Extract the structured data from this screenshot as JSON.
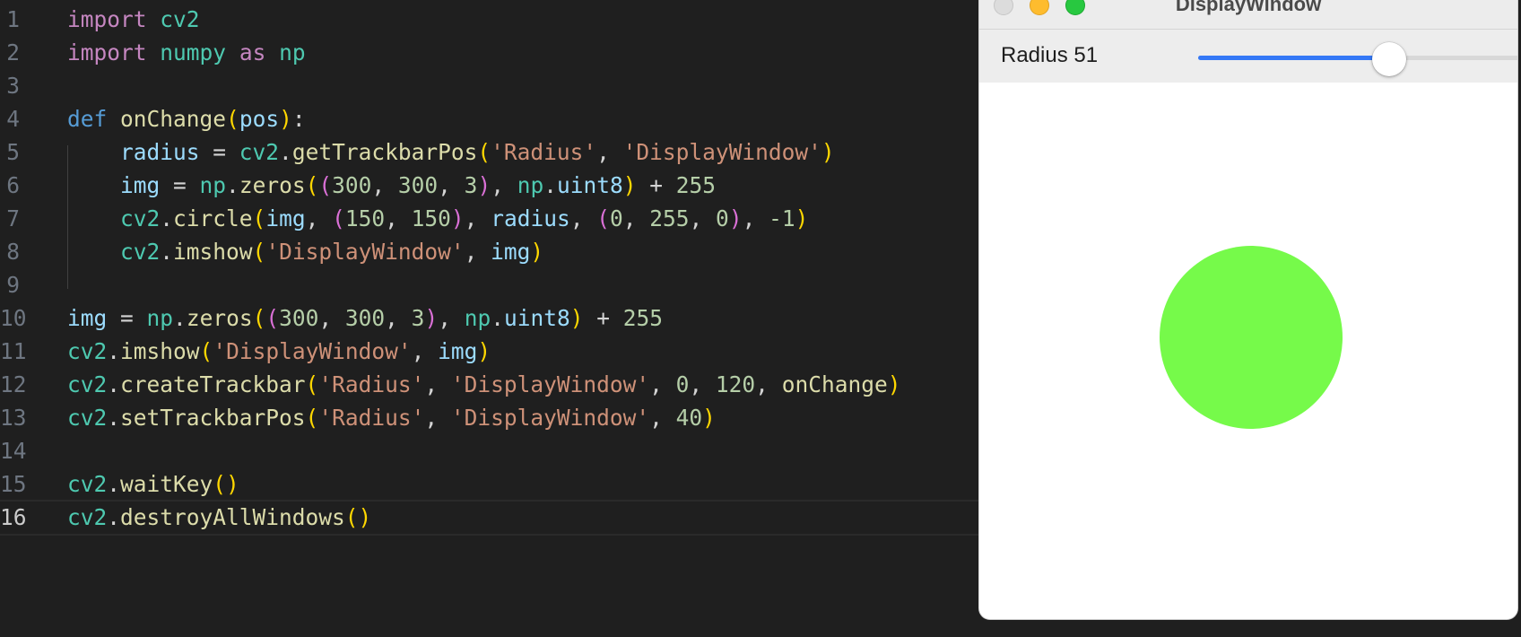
{
  "editor": {
    "lines": [
      {
        "n": "1",
        "tokens": [
          {
            "t": "import",
            "c": "kw"
          },
          {
            "t": " ",
            "c": "op"
          },
          {
            "t": "cv2",
            "c": "mod"
          }
        ]
      },
      {
        "n": "2",
        "tokens": [
          {
            "t": "import",
            "c": "kw"
          },
          {
            "t": " ",
            "c": "op"
          },
          {
            "t": "numpy",
            "c": "mod"
          },
          {
            "t": " ",
            "c": "op"
          },
          {
            "t": "as",
            "c": "kw"
          },
          {
            "t": " ",
            "c": "op"
          },
          {
            "t": "np",
            "c": "mod"
          }
        ]
      },
      {
        "n": "3",
        "tokens": []
      },
      {
        "n": "4",
        "tokens": [
          {
            "t": "def",
            "c": "def"
          },
          {
            "t": " ",
            "c": "op"
          },
          {
            "t": "onChange",
            "c": "fn"
          },
          {
            "t": "(",
            "c": "p1"
          },
          {
            "t": "pos",
            "c": "var"
          },
          {
            "t": ")",
            "c": "p1"
          },
          {
            "t": ":",
            "c": "op"
          }
        ]
      },
      {
        "n": "5",
        "tokens": [
          {
            "t": "    radius",
            "c": "var"
          },
          {
            "t": " = ",
            "c": "op"
          },
          {
            "t": "cv2",
            "c": "mod"
          },
          {
            "t": ".",
            "c": "op"
          },
          {
            "t": "getTrackbarPos",
            "c": "fn"
          },
          {
            "t": "(",
            "c": "p1"
          },
          {
            "t": "'Radius'",
            "c": "str"
          },
          {
            "t": ", ",
            "c": "op"
          },
          {
            "t": "'DisplayWindow'",
            "c": "str"
          },
          {
            "t": ")",
            "c": "p1"
          }
        ]
      },
      {
        "n": "6",
        "tokens": [
          {
            "t": "    img",
            "c": "var"
          },
          {
            "t": " = ",
            "c": "op"
          },
          {
            "t": "np",
            "c": "mod"
          },
          {
            "t": ".",
            "c": "op"
          },
          {
            "t": "zeros",
            "c": "fn"
          },
          {
            "t": "(",
            "c": "p1"
          },
          {
            "t": "(",
            "c": "p2"
          },
          {
            "t": "300",
            "c": "num"
          },
          {
            "t": ", ",
            "c": "op"
          },
          {
            "t": "300",
            "c": "num"
          },
          {
            "t": ", ",
            "c": "op"
          },
          {
            "t": "3",
            "c": "num"
          },
          {
            "t": ")",
            "c": "p2"
          },
          {
            "t": ", ",
            "c": "op"
          },
          {
            "t": "np",
            "c": "mod"
          },
          {
            "t": ".",
            "c": "op"
          },
          {
            "t": "uint8",
            "c": "var"
          },
          {
            "t": ")",
            "c": "p1"
          },
          {
            "t": " + ",
            "c": "op"
          },
          {
            "t": "255",
            "c": "num"
          }
        ]
      },
      {
        "n": "7",
        "tokens": [
          {
            "t": "    cv2",
            "c": "mod"
          },
          {
            "t": ".",
            "c": "op"
          },
          {
            "t": "circle",
            "c": "fn"
          },
          {
            "t": "(",
            "c": "p1"
          },
          {
            "t": "img",
            "c": "var"
          },
          {
            "t": ", ",
            "c": "op"
          },
          {
            "t": "(",
            "c": "p2"
          },
          {
            "t": "150",
            "c": "num"
          },
          {
            "t": ", ",
            "c": "op"
          },
          {
            "t": "150",
            "c": "num"
          },
          {
            "t": ")",
            "c": "p2"
          },
          {
            "t": ", ",
            "c": "op"
          },
          {
            "t": "radius",
            "c": "var"
          },
          {
            "t": ", ",
            "c": "op"
          },
          {
            "t": "(",
            "c": "p2"
          },
          {
            "t": "0",
            "c": "num"
          },
          {
            "t": ", ",
            "c": "op"
          },
          {
            "t": "255",
            "c": "num"
          },
          {
            "t": ", ",
            "c": "op"
          },
          {
            "t": "0",
            "c": "num"
          },
          {
            "t": ")",
            "c": "p2"
          },
          {
            "t": ", ",
            "c": "op"
          },
          {
            "t": "-1",
            "c": "num"
          },
          {
            "t": ")",
            "c": "p1"
          }
        ]
      },
      {
        "n": "8",
        "tokens": [
          {
            "t": "    cv2",
            "c": "mod"
          },
          {
            "t": ".",
            "c": "op"
          },
          {
            "t": "imshow",
            "c": "fn"
          },
          {
            "t": "(",
            "c": "p1"
          },
          {
            "t": "'DisplayWindow'",
            "c": "str"
          },
          {
            "t": ", ",
            "c": "op"
          },
          {
            "t": "img",
            "c": "var"
          },
          {
            "t": ")",
            "c": "p1"
          }
        ]
      },
      {
        "n": "9",
        "tokens": []
      },
      {
        "n": "10",
        "tokens": [
          {
            "t": "img",
            "c": "var"
          },
          {
            "t": " = ",
            "c": "op"
          },
          {
            "t": "np",
            "c": "mod"
          },
          {
            "t": ".",
            "c": "op"
          },
          {
            "t": "zeros",
            "c": "fn"
          },
          {
            "t": "(",
            "c": "p1"
          },
          {
            "t": "(",
            "c": "p2"
          },
          {
            "t": "300",
            "c": "num"
          },
          {
            "t": ", ",
            "c": "op"
          },
          {
            "t": "300",
            "c": "num"
          },
          {
            "t": ", ",
            "c": "op"
          },
          {
            "t": "3",
            "c": "num"
          },
          {
            "t": ")",
            "c": "p2"
          },
          {
            "t": ", ",
            "c": "op"
          },
          {
            "t": "np",
            "c": "mod"
          },
          {
            "t": ".",
            "c": "op"
          },
          {
            "t": "uint8",
            "c": "var"
          },
          {
            "t": ")",
            "c": "p1"
          },
          {
            "t": " + ",
            "c": "op"
          },
          {
            "t": "255",
            "c": "num"
          }
        ]
      },
      {
        "n": "11",
        "tokens": [
          {
            "t": "cv2",
            "c": "mod"
          },
          {
            "t": ".",
            "c": "op"
          },
          {
            "t": "imshow",
            "c": "fn"
          },
          {
            "t": "(",
            "c": "p1"
          },
          {
            "t": "'DisplayWindow'",
            "c": "str"
          },
          {
            "t": ", ",
            "c": "op"
          },
          {
            "t": "img",
            "c": "var"
          },
          {
            "t": ")",
            "c": "p1"
          }
        ]
      },
      {
        "n": "12",
        "tokens": [
          {
            "t": "cv2",
            "c": "mod"
          },
          {
            "t": ".",
            "c": "op"
          },
          {
            "t": "createTrackbar",
            "c": "fn"
          },
          {
            "t": "(",
            "c": "p1"
          },
          {
            "t": "'Radius'",
            "c": "str"
          },
          {
            "t": ", ",
            "c": "op"
          },
          {
            "t": "'DisplayWindow'",
            "c": "str"
          },
          {
            "t": ", ",
            "c": "op"
          },
          {
            "t": "0",
            "c": "num"
          },
          {
            "t": ", ",
            "c": "op"
          },
          {
            "t": "120",
            "c": "num"
          },
          {
            "t": ", ",
            "c": "op"
          },
          {
            "t": "onChange",
            "c": "fn"
          },
          {
            "t": ")",
            "c": "p1"
          }
        ]
      },
      {
        "n": "13",
        "tokens": [
          {
            "t": "cv2",
            "c": "mod"
          },
          {
            "t": ".",
            "c": "op"
          },
          {
            "t": "setTrackbarPos",
            "c": "fn"
          },
          {
            "t": "(",
            "c": "p1"
          },
          {
            "t": "'Radius'",
            "c": "str"
          },
          {
            "t": ", ",
            "c": "op"
          },
          {
            "t": "'DisplayWindow'",
            "c": "str"
          },
          {
            "t": ", ",
            "c": "op"
          },
          {
            "t": "40",
            "c": "num"
          },
          {
            "t": ")",
            "c": "p1"
          }
        ]
      },
      {
        "n": "14",
        "tokens": []
      },
      {
        "n": "15",
        "tokens": [
          {
            "t": "cv2",
            "c": "mod"
          },
          {
            "t": ".",
            "c": "op"
          },
          {
            "t": "waitKey",
            "c": "fn"
          },
          {
            "t": "()",
            "c": "p1"
          }
        ]
      },
      {
        "n": "16",
        "tokens": [
          {
            "t": "cv2",
            "c": "mod"
          },
          {
            "t": ".",
            "c": "op"
          },
          {
            "t": "destroyAllWindows",
            "c": "fn"
          },
          {
            "t": "()",
            "c": "p1"
          }
        ]
      }
    ],
    "current_line": "16"
  },
  "display_window": {
    "title": "DisplayWindow",
    "trackbar": {
      "label": "Radius 51",
      "name": "Radius",
      "value": 51,
      "min": 0,
      "max": 120
    },
    "circle_color": "#76fa4a"
  },
  "colors": {
    "editor_bg": "#1f1f1f",
    "slider_accent": "#3478f6"
  }
}
